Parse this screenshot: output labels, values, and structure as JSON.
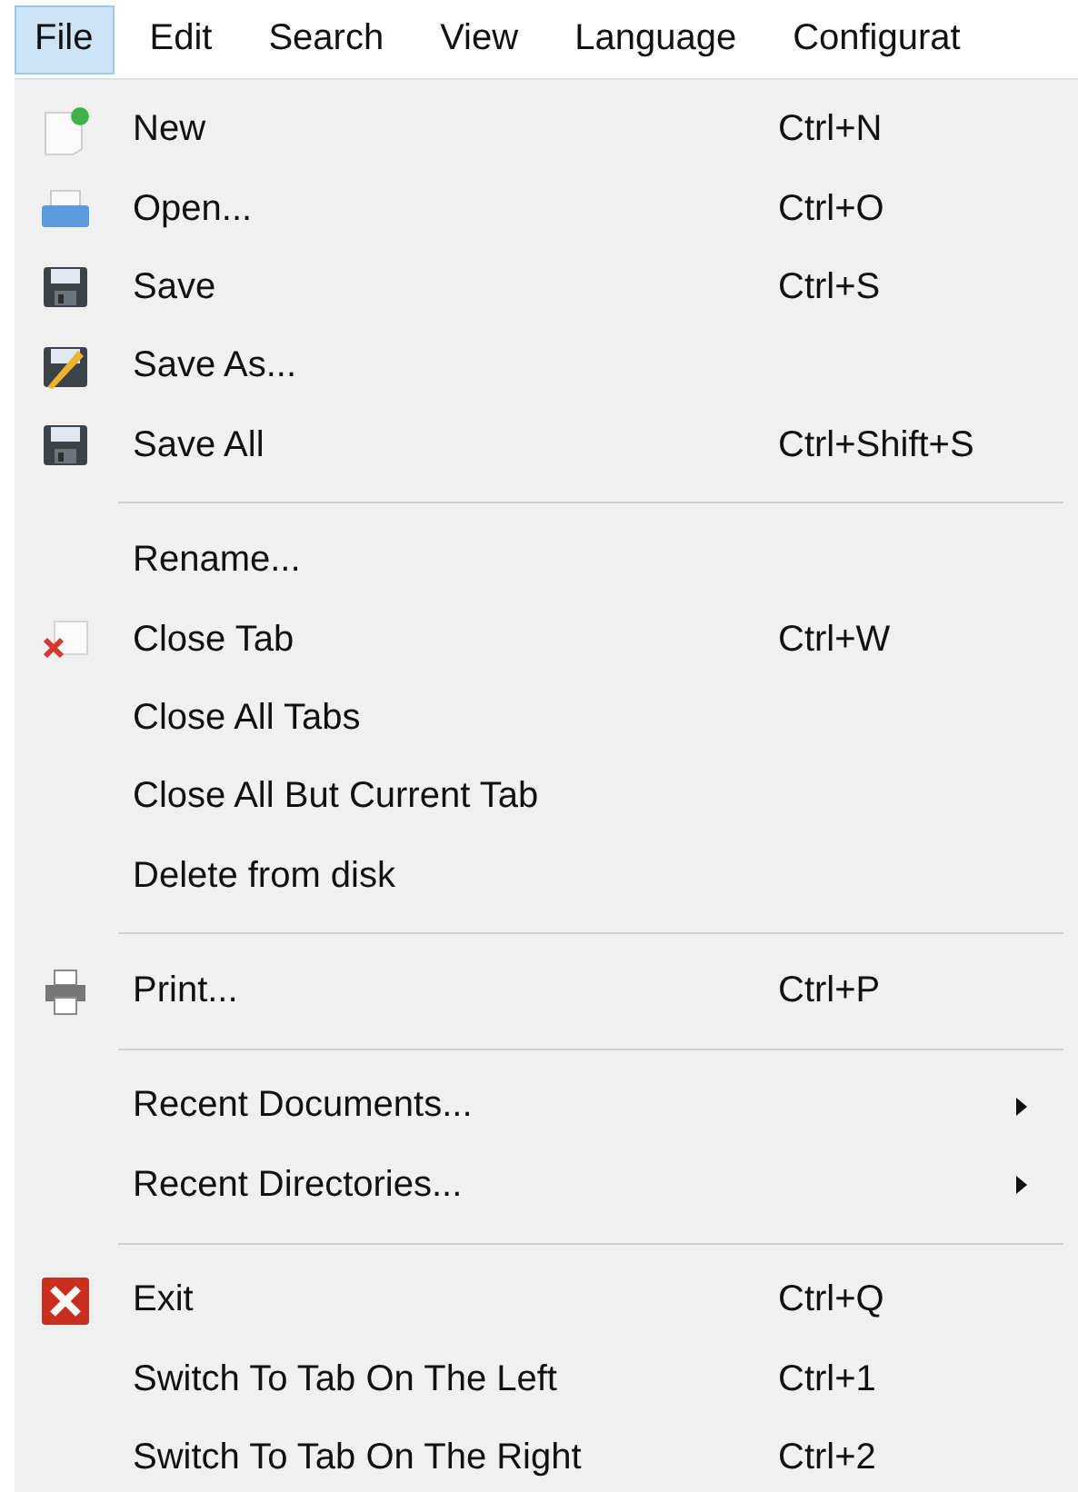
{
  "menubar": [
    {
      "label": "File",
      "selected": true
    },
    {
      "label": "Edit",
      "selected": false
    },
    {
      "label": "Search",
      "selected": false
    },
    {
      "label": "View",
      "selected": false
    },
    {
      "label": "Language",
      "selected": false
    },
    {
      "label": "Configurat",
      "selected": false
    }
  ],
  "menu": [
    {
      "kind": "item",
      "label": "New",
      "shortcut": "Ctrl+N"
    },
    {
      "kind": "item",
      "label": "Open...",
      "shortcut": "Ctrl+O"
    },
    {
      "kind": "item",
      "label": "Save",
      "shortcut": "Ctrl+S"
    },
    {
      "kind": "item",
      "label": "Save As..."
    },
    {
      "kind": "item",
      "label": "Save All",
      "shortcut": "Ctrl+Shift+S"
    },
    {
      "kind": "separator"
    },
    {
      "kind": "item",
      "label": "Rename..."
    },
    {
      "kind": "item",
      "label": "Close Tab",
      "shortcut": "Ctrl+W"
    },
    {
      "kind": "item",
      "label": "Close All Tabs"
    },
    {
      "kind": "item",
      "label": "Close All But Current Tab"
    },
    {
      "kind": "item",
      "label": "Delete from disk"
    },
    {
      "kind": "separator"
    },
    {
      "kind": "item",
      "label": "Print...",
      "shortcut": "Ctrl+P"
    },
    {
      "kind": "separator"
    },
    {
      "kind": "item",
      "label": "Recent Documents...",
      "submenu": true
    },
    {
      "kind": "item",
      "label": "Recent Directories...",
      "submenu": true
    },
    {
      "kind": "separator"
    },
    {
      "kind": "item",
      "label": "Exit",
      "shortcut": "Ctrl+Q"
    },
    {
      "kind": "item",
      "label": "Switch To Tab On The Left",
      "shortcut": "Ctrl+1"
    },
    {
      "kind": "item",
      "label": "Switch To Tab On The Right",
      "shortcut": "Ctrl+2"
    }
  ]
}
